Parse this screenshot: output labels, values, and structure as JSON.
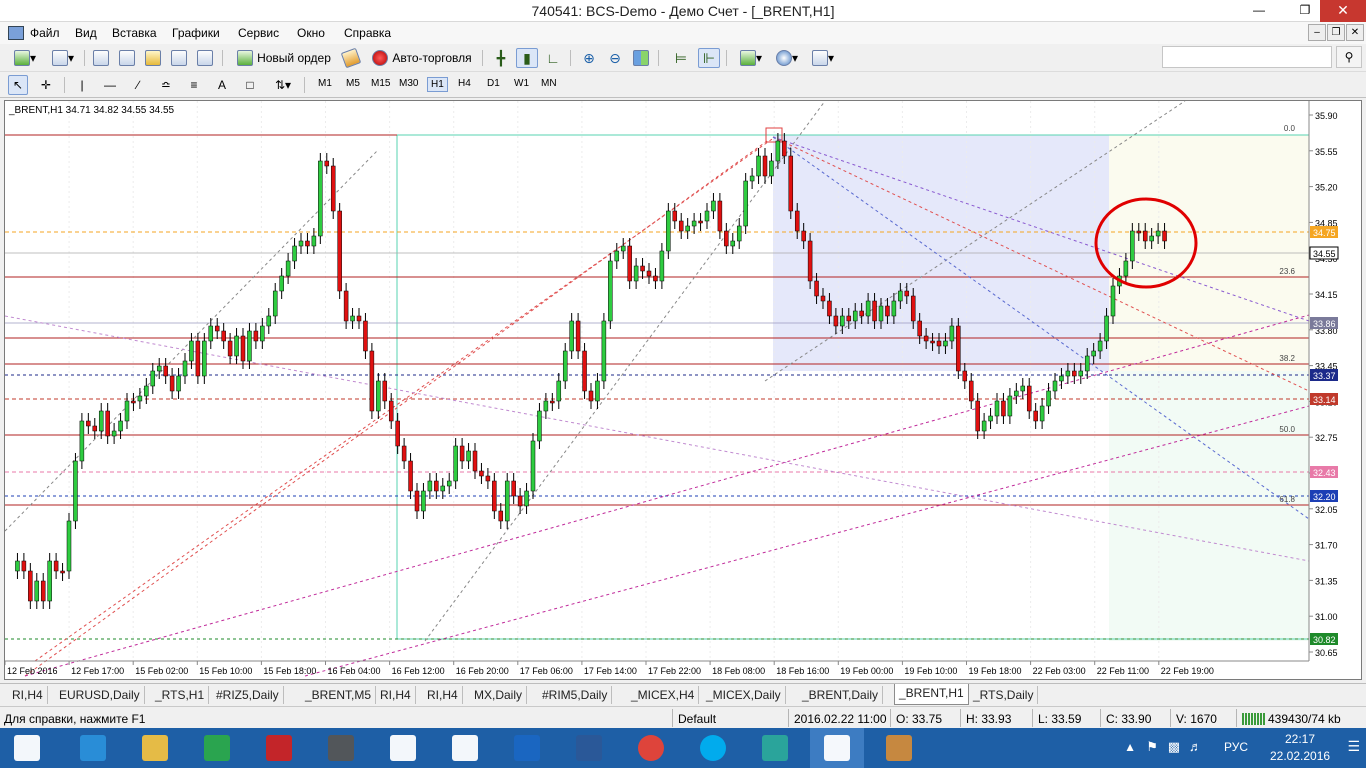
{
  "window": {
    "title": "740541: BCS-Demo - Демо Счет - [_BRENT,H1]",
    "minimize_icon": "minimize-icon",
    "restore_icon": "restore-icon",
    "close_icon": "close-icon"
  },
  "menu": {
    "items": [
      "Файл",
      "Вид",
      "Вставка",
      "Графики",
      "Сервис",
      "Окно",
      "Справка"
    ]
  },
  "toolbar": {
    "new_order": "Новый ордер",
    "auto_trading": "Авто-торговля"
  },
  "timeframes": [
    "M1",
    "M5",
    "M15",
    "M30",
    "H1",
    "H4",
    "D1",
    "W1",
    "MN"
  ],
  "active_timeframe": "H1",
  "chart": {
    "header": "_BRENT,H1  34.71 34.82 34.55 34.55",
    "price_labels": [
      "35.90",
      "35.55",
      "35.20",
      "34.85",
      "34.50",
      "34.15",
      "33.80",
      "33.45",
      "33.10",
      "32.75",
      "32.40",
      "32.05",
      "31.70",
      "31.35",
      "31.00",
      "30.65"
    ],
    "badges": [
      {
        "text": "34.75",
        "color": "#f5a623"
      },
      {
        "text": "34.55",
        "color": "#000000"
      },
      {
        "text": "33.86",
        "color": "#7a7a9a"
      },
      {
        "text": "33.37",
        "color": "#1c2a8a"
      },
      {
        "text": "33.14",
        "color": "#c0392b"
      },
      {
        "text": "32.43",
        "color": "#e87aa8"
      },
      {
        "text": "32.20",
        "color": "#1c3fb5"
      },
      {
        "text": "30.82",
        "color": "#1e8a2a"
      }
    ],
    "fib_labels": [
      "0.0",
      "23.6",
      "38.2",
      "50.0",
      "61.8"
    ],
    "time_labels": [
      "12 Feb 2016",
      "12 Feb 17:00",
      "15 Feb 02:00",
      "15 Feb 10:00",
      "15 Feb 18:00",
      "16 Feb 04:00",
      "16 Feb 12:00",
      "16 Feb 20:00",
      "17 Feb 06:00",
      "17 Feb 14:00",
      "17 Feb 22:00",
      "18 Feb 08:00",
      "18 Feb 16:00",
      "19 Feb 00:00",
      "19 Feb 10:00",
      "19 Feb 18:00",
      "22 Feb 03:00",
      "22 Feb 11:00",
      "22 Feb 19:00"
    ]
  },
  "tabs": [
    "RI,H4",
    "EURUSD,Daily",
    "_RTS,H1",
    "#RIZ5,Daily",
    "_BRENT,M5",
    "RI,H4",
    "RI,H4",
    "MX,Daily",
    "#RIM5,Daily",
    "_MICEX,H4",
    "_MICEX,Daily",
    "_BRENT,Daily",
    "_BRENT,H1",
    "_RTS,Daily"
  ],
  "active_tab": "_BRENT,H1",
  "status": {
    "help": "Для справки, нажмите F1",
    "profile": "Default",
    "datetime": "2016.02.22 11:00",
    "open": "O: 33.75",
    "high": "H: 33.93",
    "low": "L: 33.59",
    "close": "C: 33.90",
    "volume": "V: 1670",
    "traffic": "439430/74 kb"
  },
  "taskbar": {
    "items": [
      "windows-start-icon",
      "internet-explorer-icon",
      "file-explorer-icon",
      "store-icon",
      "lenovo-icon",
      "shield-app-icon",
      "document-icon",
      "home-app-icon",
      "maxthon-icon",
      "word-icon",
      "chrome-icon",
      "skype-icon",
      "q-app-icon",
      "metatrader-icon",
      "paint-icon"
    ],
    "lang": "РУС",
    "time": "22:17",
    "date": "22.02.2016"
  }
}
